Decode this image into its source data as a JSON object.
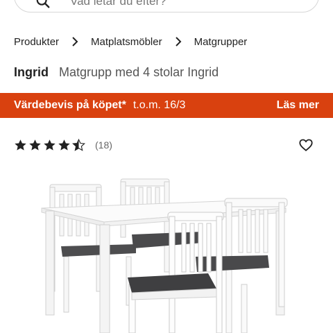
{
  "search": {
    "placeholder": "Vad letar du efter?"
  },
  "breadcrumb": {
    "items": [
      {
        "label": "Produkter"
      },
      {
        "label": "Matplatsmöbler"
      },
      {
        "label": "Matgrupper"
      }
    ]
  },
  "product": {
    "brand": "Ingrid",
    "name": "Matgrupp med 4 stolar Ingrid",
    "rating": 4.5,
    "review_count": "(18)"
  },
  "promo": {
    "title": "Värdebevis på köpet*",
    "date": "t.o.m. 16/3",
    "link": "Läs mer",
    "color": "#d9410f"
  },
  "icons": {
    "search": "search-icon",
    "chevron": "chevron-right-icon",
    "star": "star-icon",
    "heart": "heart-outline-icon"
  }
}
